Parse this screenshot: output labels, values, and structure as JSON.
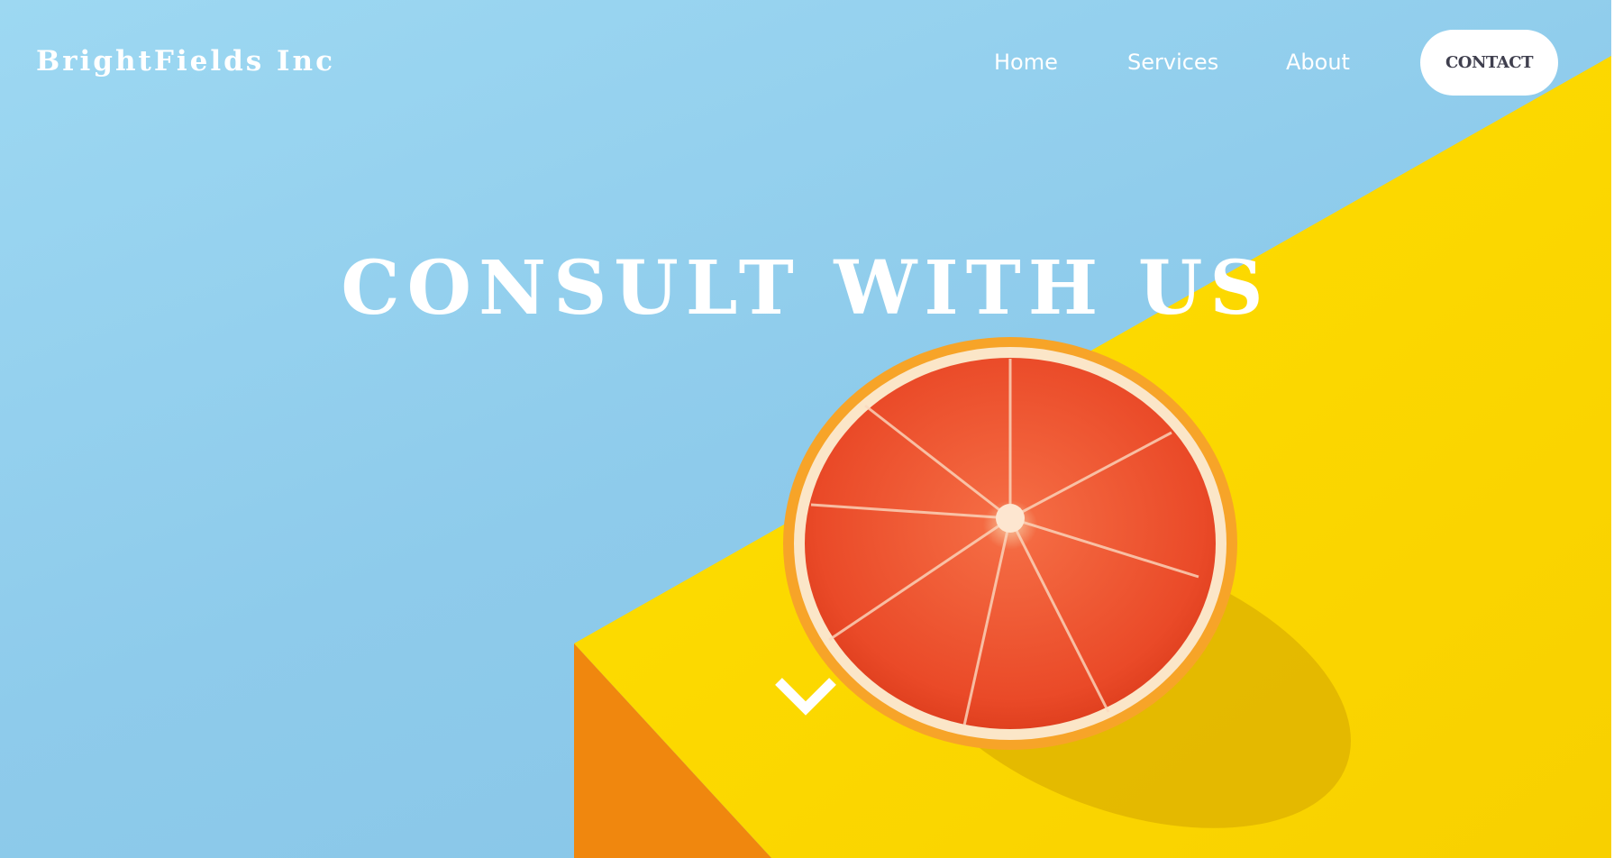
{
  "header": {
    "logo": "BrightFields Inc",
    "nav": [
      "Home",
      "Services",
      "About"
    ],
    "contact_label": "CONTACT"
  },
  "hero": {
    "heading": "CONSULT WITH US",
    "scroll_icon": "chevron-down-icon"
  },
  "colors": {
    "sky": "#8ecbeb",
    "yellow": "#ffd800",
    "orange": "#f08a10",
    "fruit": "#f0502a"
  }
}
